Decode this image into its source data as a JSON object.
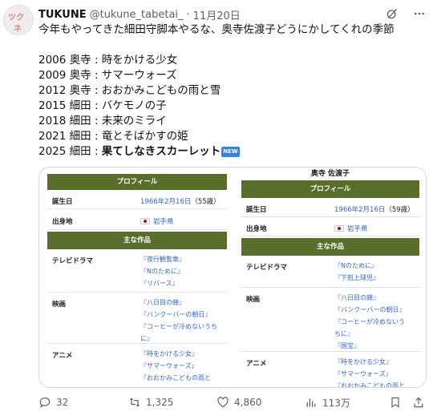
{
  "author": {
    "name": "TUKUNE",
    "handle": "@tukune_tabetai_",
    "separator": "·",
    "date": "11月20日",
    "avatar_text": [
      "ツク",
      "ネ"
    ]
  },
  "tweet": {
    "line1": "今年もやってきた細田守脚本やるな、奥寺佐渡子どうにかしてくれの季節",
    "list": [
      "2006 奥寺 : 時をかける少女",
      "2009 奥寺 : サマーウォーズ",
      "2012 奥寺 : おおかみこどもの雨と雪",
      "2015 細田 : バケモノの子",
      "2018 細田 : 未来のミライ",
      "2021 細田 : 竜とそばかすの姫"
    ],
    "last_prefix": "2025 細田 : ",
    "last_bold": "果てしなきスカーレット",
    "new_badge": "NEW"
  },
  "media": {
    "left": {
      "profile_header": "プロフィール",
      "birth_label": "誕生日",
      "birth_value": "1966年2月16日",
      "birth_age": "（55歳）",
      "origin_label": "出身地",
      "origin_value": "岩手県",
      "works_header": "主な作品",
      "tv_label": "テレビドラマ",
      "tv_works": [
        "『夜行観覧車』",
        "『Nのために』",
        "『リバース』"
      ],
      "film_label": "映画",
      "film_works": [
        "『八日目の蝉』",
        "『バンクーバーの朝日』",
        "『コーヒーが冷めないうち",
        "に』"
      ],
      "anime_label": "アニメ",
      "anime_works": [
        "『時をかける少女』",
        "『サマーウォーズ』",
        "『おおかみこどもの雨と"
      ]
    },
    "right": {
      "title": "奥寺 佐渡子",
      "profile_header": "プロフィール",
      "birth_label": "誕生日",
      "birth_value": "1966年2月16日",
      "birth_age": "（59歳）",
      "origin_label": "出身地",
      "origin_value": "岩手県",
      "works_header": "主な作品",
      "tv_label": "テレビドラマ",
      "tv_works": [
        "『Nのために』",
        "『下剋上球児』"
      ],
      "film_label": "映画",
      "film_works": [
        "『八日目の蝉』",
        "『バンクーバーの朝日』",
        "『コーヒーが冷めないう",
        "ちに』",
        "『国宝』"
      ],
      "anime_label": "アニメ",
      "anime_works": [
        "『時をかける少女』",
        "『サマーウォーズ』",
        "『おおかみこどもの雨と"
      ]
    }
  },
  "actions": {
    "replies": "32",
    "reposts": "1,325",
    "likes": "4,860",
    "views": "113万"
  },
  "colors": {
    "band": "#5a6e2c",
    "link": "#3366cc",
    "muted": "#536471"
  }
}
